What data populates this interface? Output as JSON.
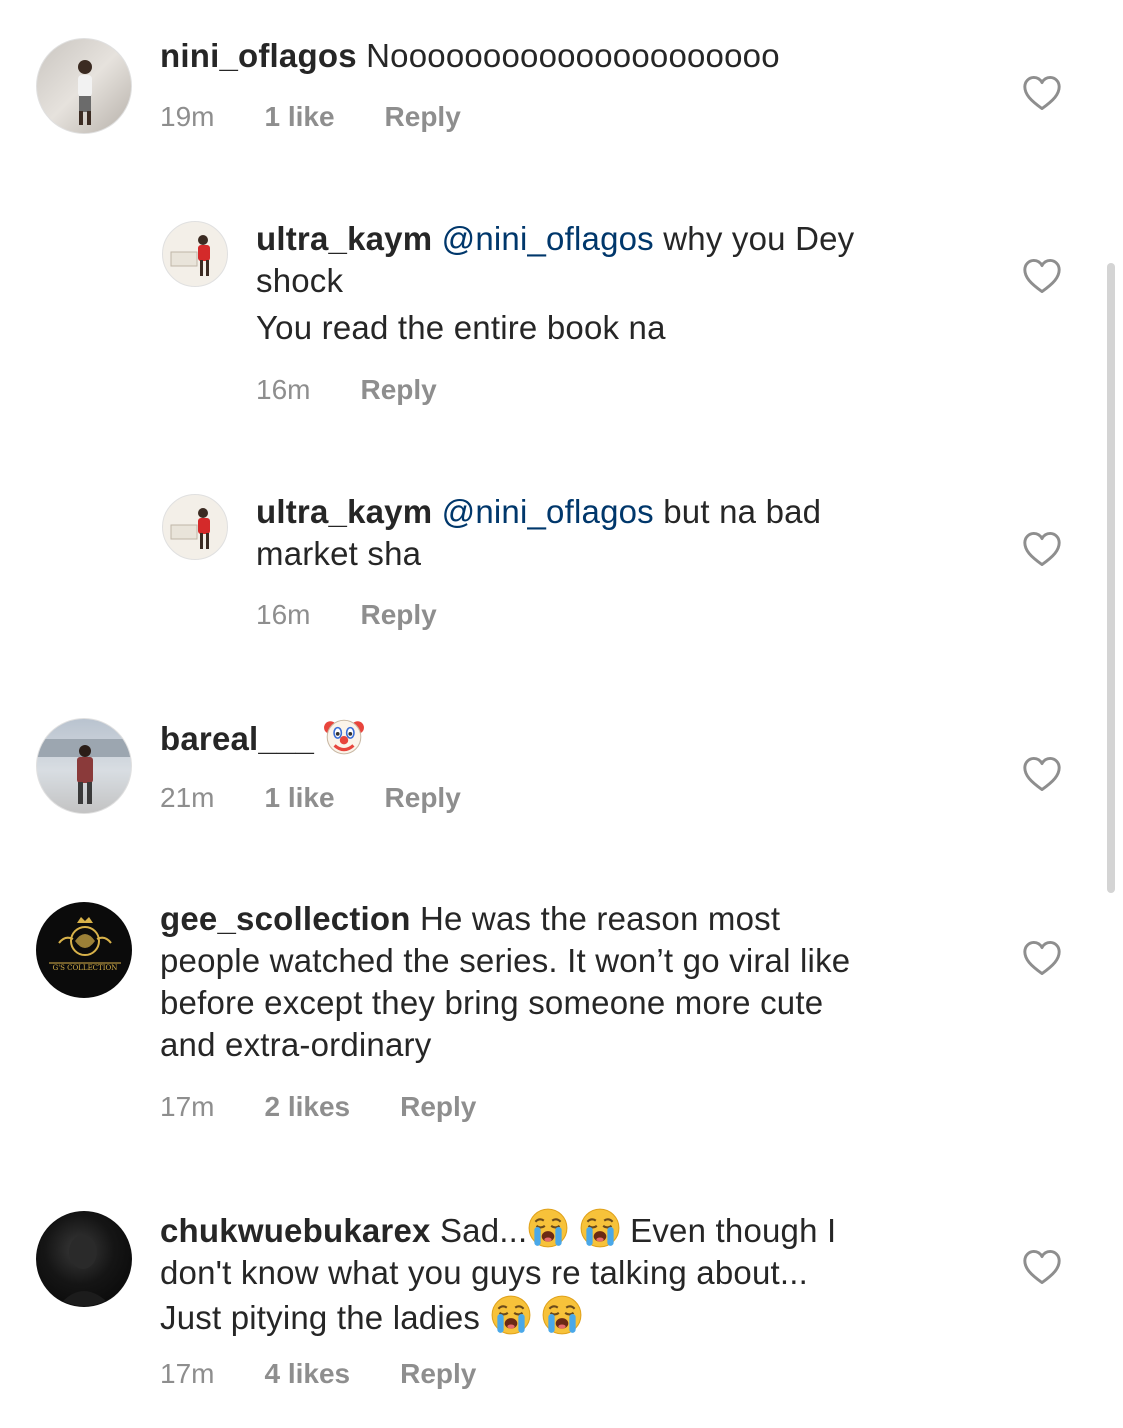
{
  "comments": [
    {
      "username": "nini_oflagos",
      "text": "Nooooooooooooooooooooo",
      "time": "19m",
      "likes": "1 like",
      "reply": "Reply",
      "avatar_icon": "user-photo-avatar"
    },
    {
      "username": "ultra_kaym",
      "mention": "@nini_oflagos",
      "text_line1": "why you Dey",
      "text_line2": "shock",
      "text_line3": "You read the entire book na",
      "time": "16m",
      "reply": "Reply",
      "avatar_icon": "user-photo-avatar"
    },
    {
      "username": "ultra_kaym",
      "mention": "@nini_oflagos",
      "text_line1": "but na bad",
      "text_line2": "market sha",
      "time": "16m",
      "reply": "Reply",
      "avatar_icon": "user-photo-avatar"
    },
    {
      "username": "bareal___",
      "emoji": "clown-face-emoji",
      "time": "21m",
      "likes": "1 like",
      "reply": "Reply",
      "avatar_icon": "user-photo-avatar"
    },
    {
      "username": "gee_scollection",
      "text_line1": "He was the reason most",
      "text_line2": "people watched the series. It won’t go viral like",
      "text_line3": "before except they bring someone more cute",
      "text_line4": "and extra-ordinary",
      "time": "17m",
      "likes": "2 likes",
      "reply": "Reply",
      "avatar_text": "G'S COLLECTION"
    },
    {
      "username": "chukwuebukarex",
      "text_line1a": "Sad...",
      "text_line1b": "Even though I",
      "text_line2": "don't know what you guys re talking about...",
      "text_line3": "Just pitying the ladies",
      "emoji": "loudly-crying-face-emoji",
      "time": "17m",
      "likes": "4 likes",
      "reply": "Reply",
      "avatar_icon": "user-photo-avatar"
    }
  ],
  "colors": {
    "text": "#262626",
    "meta": "#8e8e8e",
    "mention": "#00376b"
  }
}
